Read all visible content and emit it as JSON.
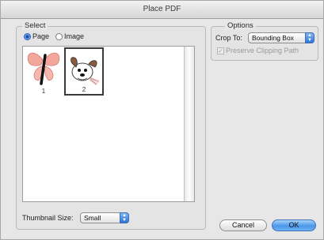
{
  "window": {
    "title": "Place PDF"
  },
  "select_group": {
    "label": "Select",
    "radio_page": "Page",
    "radio_image": "Image",
    "selected": "Page"
  },
  "thumbnails": [
    {
      "number": "1",
      "selected": false
    },
    {
      "number": "2",
      "selected": true
    }
  ],
  "thumbnail_size": {
    "label": "Thumbnail Size:",
    "value": "Small"
  },
  "options_group": {
    "label": "Options",
    "crop_label": "Crop To:",
    "crop_value": "Bounding Box",
    "preserve_label": "Preserve Clipping Path",
    "preserve_checked": true,
    "preserve_enabled": false
  },
  "buttons": {
    "cancel": "Cancel",
    "ok": "OK"
  }
}
